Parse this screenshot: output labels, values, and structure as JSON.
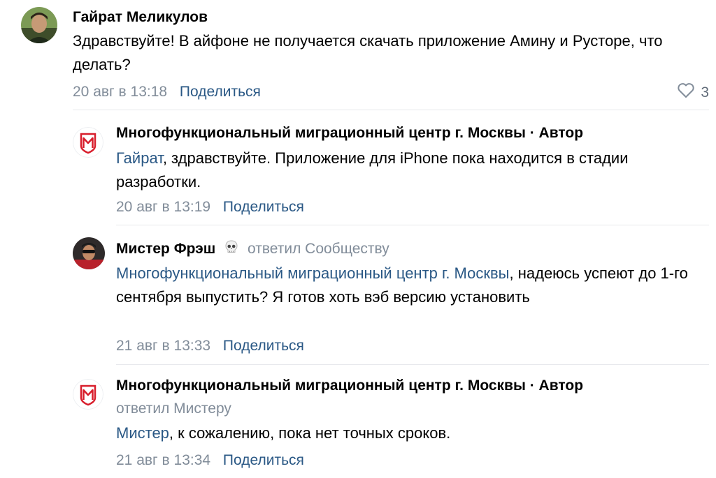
{
  "comments": [
    {
      "author": "Гайрат Меликулов",
      "text": "Здравствуйте! В айфоне не получается скачать приложение Амину и Русторе, что делать?",
      "date": "20 авг в 13:18",
      "share": "Поделиться",
      "likes": "3"
    },
    {
      "author": "Многофункциональный миграционный центр г. Москвы · Автор",
      "mention": "Гайрат",
      "text": ", здравствуйте. Приложение для iPhone пока находится в стадии разработки.",
      "date": "20 авг в 13:19",
      "share": "Поделиться"
    },
    {
      "author": "Мистер Фрэш",
      "replied": "ответил Сообществу",
      "mention": "Многофункциональный миграционный центр г. Москвы",
      "text": ", надеюсь успеют до 1-го сентября выпустить? Я готов хоть вэб версию установить",
      "date": "21 авг в 13:33",
      "share": "Поделиться"
    },
    {
      "author": "Многофункциональный миграционный центр г. Москвы · Автор",
      "replied": "ответил Мистеру",
      "mention": "Мистер",
      "text": ", к сожалению, пока нет точных сроков.",
      "date": "21 авг в 13:34",
      "share": "Поделиться"
    }
  ],
  "colors": {
    "link": "#2a5885",
    "meta": "#818c99",
    "brand_red": "#d81e2c"
  }
}
